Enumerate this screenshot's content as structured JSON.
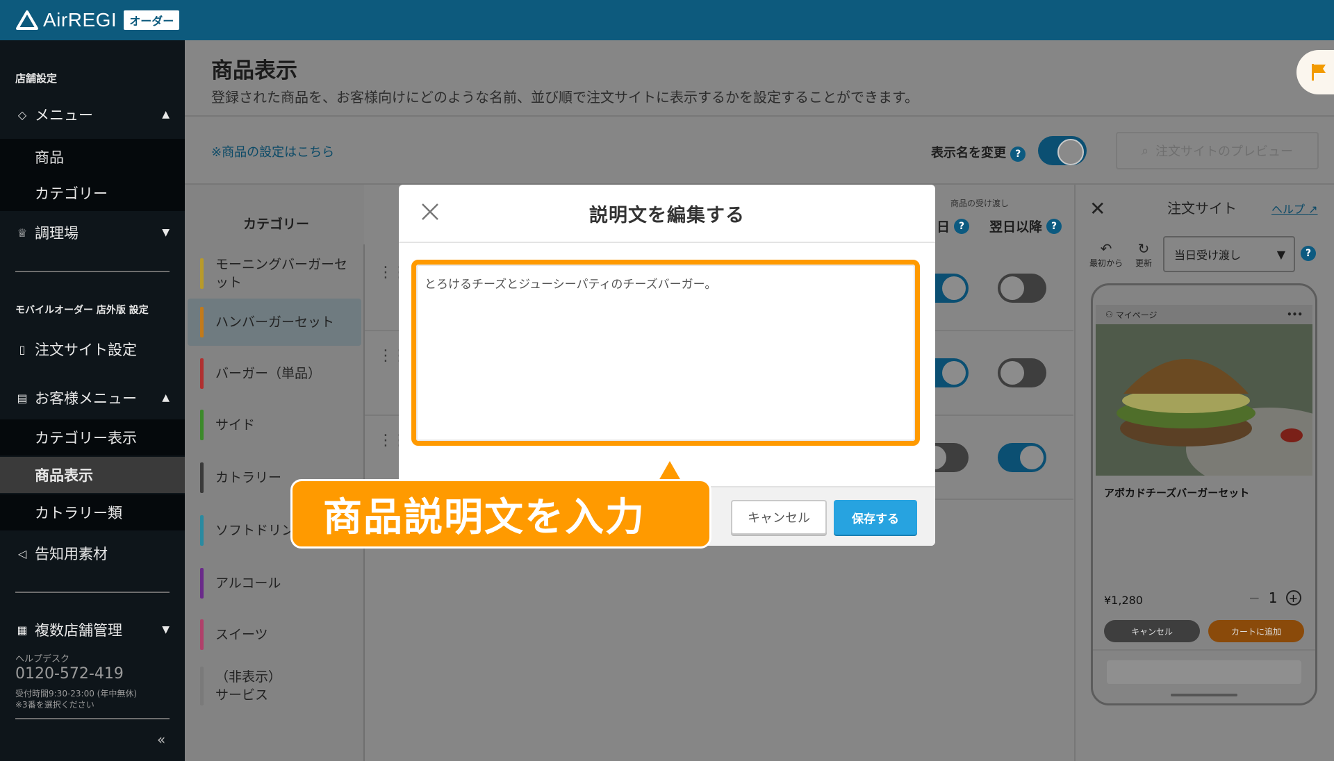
{
  "app": {
    "logo_text": "AirREGI",
    "logo_badge": "オーダー"
  },
  "sidebar": {
    "section_store": "店舗設定",
    "menu_label": "メニュー",
    "menu_sub": [
      "商品",
      "カテゴリー"
    ],
    "kitchen_label": "調理場",
    "section_mobile": "モバイルオーダー 店外版 設定",
    "order_site_label": "注文サイト設定",
    "customer_menu_label": "お客様メニュー",
    "customer_sub": [
      "カテゴリー表示",
      "商品表示",
      "カトラリー類"
    ],
    "promo_label": "告知用素材",
    "multi_store_label": "複数店舗管理",
    "helpdesk_title": "ヘルプデスク",
    "helpdesk_phone": "0120-572-419",
    "helpdesk_hours": "受付時間9:30-23:00 (年中無休)",
    "helpdesk_note": "※3番を選択ください",
    "collapse": "«"
  },
  "page": {
    "title": "商品表示",
    "description": "登録された商品を、お客様向けにどのような名前、並び順で注文サイトに表示するかを設定することができます。",
    "settings_link": "※商品の設定はこちら",
    "rename_toggle_label": "表示名を変更",
    "preview_button": "注文サイトのプレビュー"
  },
  "categories": {
    "header": "カテゴリー",
    "items": [
      {
        "label": "モーニングバーガーセット",
        "color": "#b89a2a"
      },
      {
        "label": "ハンバーガーセット",
        "color": "#c27a1a"
      },
      {
        "label": "バーガー（単品）",
        "color": "#b03030"
      },
      {
        "label": "サイド",
        "color": "#3c8a2a"
      },
      {
        "label": "カトラリー",
        "color": "#3a3a3a"
      },
      {
        "label": "ソフトドリンク",
        "color": "#2a8aa0"
      },
      {
        "label": "アルコール",
        "color": "#6a2a8a"
      },
      {
        "label": "スイーツ",
        "color": "#b0406a"
      },
      {
        "label": "（非表示）\nサービス",
        "color": "#7a7a7a"
      }
    ]
  },
  "columns": {
    "pickup_group": "商品の受け渡し",
    "same_day": "日",
    "next_day": "翌日以降"
  },
  "rows": [
    {
      "same_day_on": true,
      "next_day_on": false
    },
    {
      "same_day_on": true,
      "next_day_on": false
    },
    {
      "same_day_on": false,
      "next_day_on": true
    }
  ],
  "order_site": {
    "title": "注文サイト",
    "help": "ヘルプ",
    "reset_label": "最初から",
    "refresh_label": "更新",
    "pickup_select": "当日受け渡し",
    "mypage": "マイページ",
    "product_name": "アボカドチーズバーガーセット",
    "price": "¥1,280",
    "qty_minus": "−",
    "qty": "1",
    "qty_plus": "+",
    "cancel": "キャンセル",
    "add_to_cart": "カートに追加"
  },
  "modal": {
    "title": "説明文を編集する",
    "text": "とろけるチーズとジューシーパティのチーズバーガー。",
    "cancel": "キャンセル",
    "save": "保存する"
  },
  "callout": {
    "text": "商品説明文を入力"
  },
  "colors": {
    "header": "#0d5a7d",
    "accent_orange": "#ff9a00",
    "save_blue": "#27a3e0"
  }
}
